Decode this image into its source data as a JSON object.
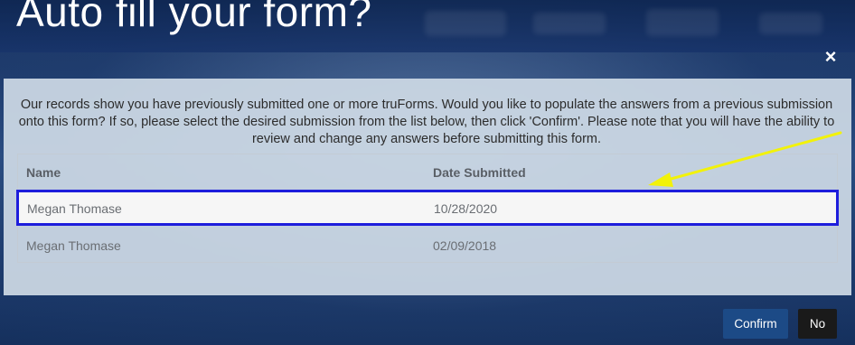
{
  "page": {
    "title": "Auto fill your form?"
  },
  "dialog": {
    "close_label": "×",
    "message": "Our records show you have previously submitted one or more truForms. Would you like to populate the answers from a previous submission onto this form? If so, please select the desired submission from the list below, then click 'Confirm'. Please note that you will have the ability to review and change any answers before submitting this form.",
    "table": {
      "columns": [
        "Name",
        "Date Submitted"
      ],
      "rows": [
        {
          "name": "Megan Thomase",
          "date": "10/28/2020",
          "selected": true
        },
        {
          "name": "Megan Thomase",
          "date": "02/09/2018",
          "selected": false
        }
      ]
    },
    "buttons": {
      "confirm": "Confirm",
      "no": "No"
    }
  },
  "colors": {
    "selection_border": "#1d1ddc",
    "annotation_arrow": "#f2f20a",
    "confirm_button": "#1c4a86",
    "no_button": "#1a1a1a"
  },
  "icons": {
    "close": "close-icon",
    "annotation": "arrow-annotation-icon"
  }
}
